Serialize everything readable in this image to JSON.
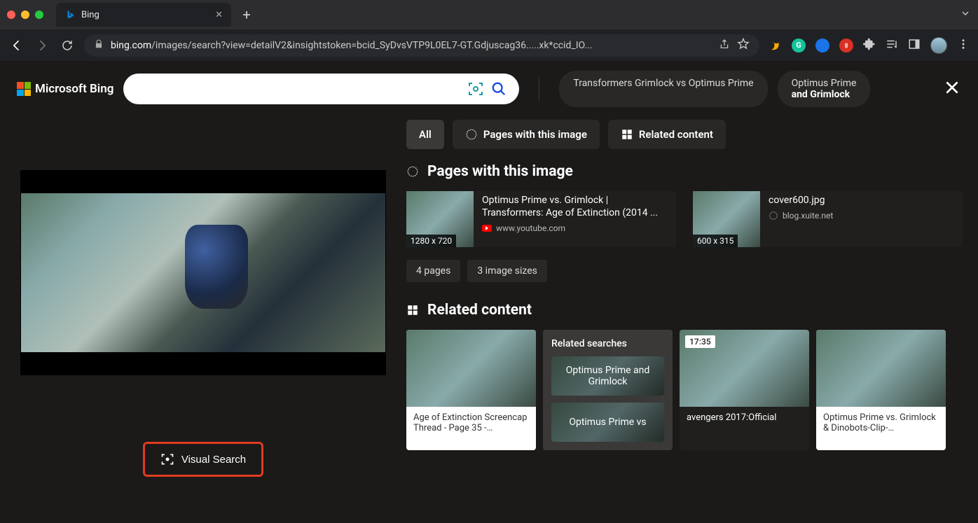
{
  "browser": {
    "tab_title": "Bing",
    "url_host": "bing.com",
    "url_path": "/images/search?view=detailV2&insightstoken=bcid_SyDvsVTP9L0EL7-GT.Gdjuscag36.....xk*ccid_IO..."
  },
  "header": {
    "logo_text": "Microsoft Bing",
    "chip1": "Transformers Grimlock vs Optimus Prime",
    "chip2_line1": "Optimus Prime",
    "chip2_line2": "and Grimlock"
  },
  "tabs": {
    "all": "All",
    "pages": "Pages with this image",
    "related": "Related content"
  },
  "sections": {
    "pages_title": "Pages with this image",
    "related_title": "Related content"
  },
  "page_cards": [
    {
      "size": "1280 x 720",
      "title": "Optimus Prime vs. Grimlock | Transformers: Age of Extinction (2014 ...",
      "source": "www.youtube.com",
      "yt": true
    },
    {
      "size": "600 x 315",
      "title": "cover600.jpg",
      "source": "blog.xuite.net",
      "yt": false
    }
  ],
  "pills": {
    "p1": "4 pages",
    "p2": "3 image sizes"
  },
  "related": {
    "card1_caption": "Age of Extinction Screencap Thread - Page 35 -…",
    "searches_title": "Related searches",
    "rs1": "Optimus Prime and Grimlock",
    "rs2": "Optimus Prime vs",
    "card3_time": "17:35",
    "card3_caption": "avengers 2017:Official",
    "card4_caption": "Optimus Prime vs. Grimlock & Dinobots-Clip-…"
  },
  "visual_search_label": "Visual Search"
}
